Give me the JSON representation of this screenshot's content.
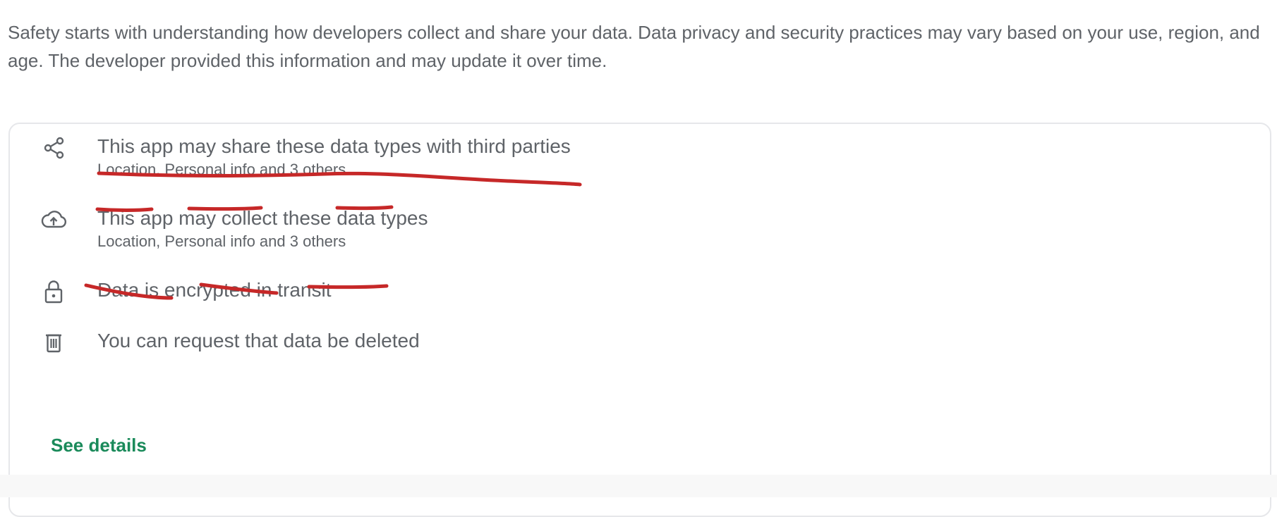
{
  "intro_text": "Safety starts with understanding how developers collect and share your data. Data privacy and security practices may vary based on your use, region, and age. The developer provided this information and may update it over time.",
  "items": [
    {
      "icon": "share-icon",
      "title": "This app may share these data types with third parties",
      "subtitle": "Location, Personal info and 3 others"
    },
    {
      "icon": "cloud-upload-icon",
      "title": "This app may collect these data types",
      "subtitle": "Location, Personal info and 3 others"
    },
    {
      "icon": "lock-icon",
      "title": "Data is encrypted in transit"
    },
    {
      "icon": "trash-icon",
      "title": "You can request that data be deleted"
    }
  ],
  "see_details_label": "See details",
  "colors": {
    "text": "#5f6368",
    "link": "#1a8a5a",
    "annotation": "#c62828",
    "border": "#e6e7ea"
  }
}
